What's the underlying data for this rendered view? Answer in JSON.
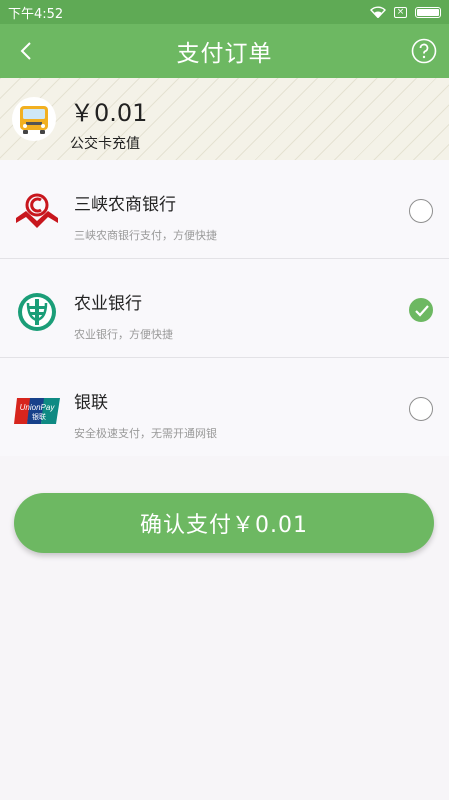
{
  "status_bar": {
    "time": "下午4:52"
  },
  "header": {
    "title": "支付订单"
  },
  "order": {
    "amount": "￥0.01",
    "description": "公交卡充值"
  },
  "banks": [
    {
      "name": "三峡农商银行",
      "subtext": "三峡农商银行支付，方便快捷",
      "selected": false,
      "icon": "sanxia-bank-logo-icon"
    },
    {
      "name": "农业银行",
      "subtext": "农业银行，方便快捷",
      "selected": true,
      "icon": "abc-bank-logo-icon"
    },
    {
      "name": "银联",
      "subtext": "安全极速支付，无需开通网银",
      "selected": false,
      "icon": "unionpay-logo-icon"
    }
  ],
  "confirm": {
    "label": "确认支付￥0.01"
  },
  "colors": {
    "accent": "#6db862",
    "status_bar": "#5faa55",
    "abc_green": "#1b9e78",
    "bank_red": "#c8161d"
  }
}
